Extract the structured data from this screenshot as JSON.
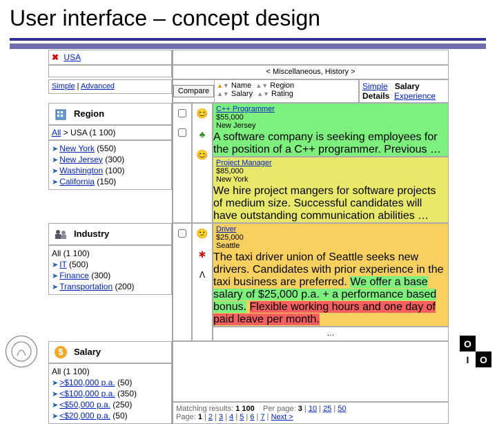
{
  "slide": {
    "title": "User interface – concept design"
  },
  "header": {
    "location_tag": "USA",
    "breadcrumb": "< Miscellaneous, History >",
    "search_modes": {
      "simple": "Simple",
      "advanced": "Advanced"
    }
  },
  "sort": {
    "compare_btn": "Compare",
    "fields": {
      "name": "Name",
      "region": "Region",
      "salary": "Salary",
      "rating": "Rating"
    }
  },
  "view_tabs": {
    "simple": "Simple",
    "details": "Details",
    "salary": "Salary",
    "experience": "Experience"
  },
  "facets": {
    "region": {
      "title": "Region",
      "breadcrumb": {
        "all": "All",
        "sep": " > ",
        "current": "USA (1 100)"
      },
      "items": [
        {
          "label": "New York",
          "count": "(550)"
        },
        {
          "label": "New Jersey",
          "count": "(300)"
        },
        {
          "label": "Washington",
          "count": "(100)"
        },
        {
          "label": "California",
          "count": "(150)"
        }
      ]
    },
    "industry": {
      "title": "Industry",
      "all": "All (1 100)",
      "items": [
        {
          "label": "IT",
          "count": "(500)"
        },
        {
          "label": "Finance",
          "count": "(300)"
        },
        {
          "label": "Transportation",
          "count": "(200)"
        }
      ]
    },
    "salary": {
      "title": "Salary",
      "all": "All (1 100)",
      "items": [
        {
          "label": ">$100,000 p.a.",
          "count": "(50)"
        },
        {
          "label": "<$100,000 p.a.",
          "count": "(350)"
        },
        {
          "label": "<$50,000 p.a.",
          "count": "(250)"
        },
        {
          "label": "<$20,000 p.a.",
          "count": "(50)"
        }
      ]
    }
  },
  "results": [
    {
      "color": "green",
      "title": "C++ Programmer",
      "salary": "$55,000",
      "location": "New Jersey",
      "desc": "A software company is seeking employees for the position of a C++ programmer. Previous …"
    },
    {
      "color": "yellow",
      "title": "Project Manager",
      "salary": "$85,000",
      "location": "New York",
      "desc": "We hire project mangers for software projects of medium size. Successful candidates will have outstanding communication abilities …"
    },
    {
      "color": "red",
      "title": "Driver",
      "salary": "$25,000",
      "location": "Seattle",
      "desc_pre": "The taxi driver union of Seattle seeks new drivers. Candidates with prior experience in the taxi business are preferred.",
      "offer": "We offer a base salary of $25,000 p.a. + a performance based bonus.",
      "desc_post": "Flexible working hours and one day of paid leave per month."
    }
  ],
  "ellipsis": "…",
  "footer": {
    "matching_label": "Matching results:",
    "matching_value": "1 100",
    "perpage_label": "Per page:",
    "perpage_options": [
      "3",
      "10",
      "25",
      "50"
    ],
    "perpage_current": "3",
    "page_label": "Page:",
    "pages": [
      "1",
      "2",
      "3",
      "4",
      "5",
      "6",
      "7"
    ],
    "page_current": "1",
    "next": "Next >"
  }
}
